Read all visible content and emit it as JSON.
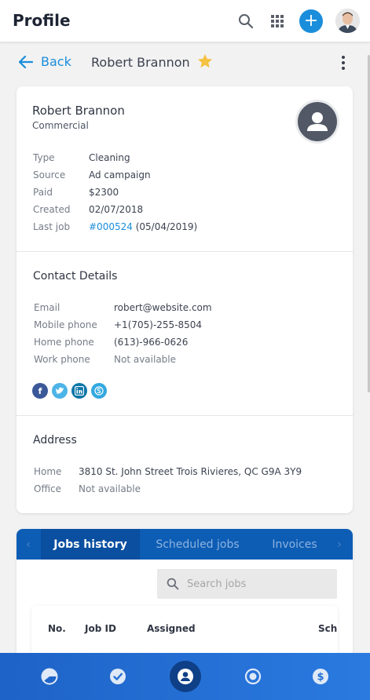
{
  "app": {
    "title": "Profile",
    "icons": [
      "search-icon",
      "apps-grid-icon",
      "add-icon",
      "user-avatar"
    ]
  },
  "header": {
    "back_label": "Back",
    "customer_name": "Robert Brannon",
    "favorite_icon": "star-icon"
  },
  "customer": {
    "name": "Robert Brannon",
    "category": "Commercial",
    "details": [
      {
        "key": "Type",
        "value": "Cleaning"
      },
      {
        "key": "Source",
        "value": "Ad campaign"
      },
      {
        "key": "Paid",
        "value": "$2300"
      },
      {
        "key": "Created",
        "value": "02/07/2018"
      }
    ],
    "last_job": {
      "key": "Last job",
      "link": "#000524",
      "date": "(05/04/2019)"
    }
  },
  "contact": {
    "title": "Contact Details",
    "rows": [
      {
        "key": "Email",
        "value": "robert@website.com"
      },
      {
        "key": "Mobile phone",
        "value": "+1(705)-255-8504"
      },
      {
        "key": "Home phone",
        "value": "(613)-966-0626"
      },
      {
        "key": "Work phone",
        "value": "Not available"
      }
    ],
    "social": [
      "facebook-icon",
      "twitter-icon",
      "linkedin-icon",
      "skype-icon"
    ]
  },
  "address": {
    "title": "Address",
    "rows": [
      {
        "key": "Home",
        "value": "3810 St. John Street Trois Rivieres, QC G9A 3Y9"
      },
      {
        "key": "Office",
        "value": "Not available"
      }
    ]
  },
  "tabs": {
    "items": [
      "Jobs history",
      "Scheduled jobs",
      "Invoices"
    ],
    "active": "Jobs history"
  },
  "jobs": {
    "search_placeholder": "Search jobs",
    "columns": [
      "No.",
      "Job ID",
      "Assigned",
      "Sch"
    ]
  },
  "bottom_nav": {
    "items": [
      "dashboard-icon",
      "tasks-check-icon",
      "profile-icon",
      "record-icon",
      "billing-dollar-icon"
    ],
    "active": "profile-icon"
  },
  "colors": {
    "accent": "#1a8ddb",
    "tab_bar": "#0d5db5",
    "nav_gradient_start": "#1e63c7",
    "star": "#f5c242"
  }
}
